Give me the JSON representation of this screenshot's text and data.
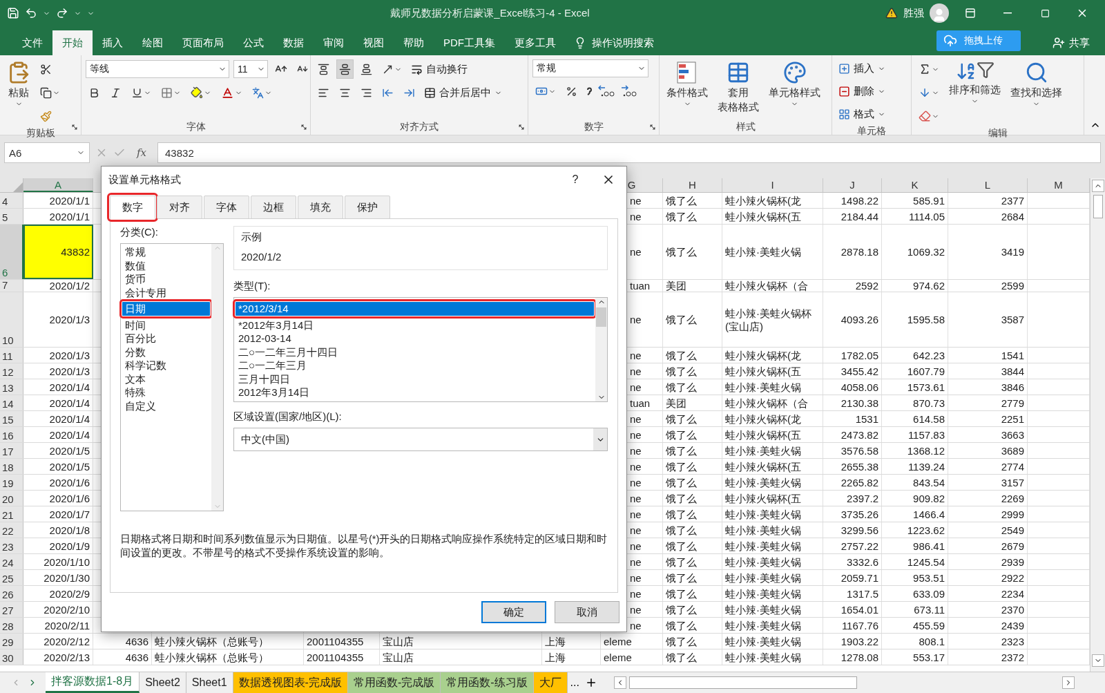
{
  "title_bar": {
    "title": "戴师兄数据分析启蒙课_Excel练习-4  -  Excel",
    "user": "胜强"
  },
  "menu_tabs": [
    {
      "label": "文件",
      "selected": false
    },
    {
      "label": "开始",
      "selected": true
    },
    {
      "label": "插入",
      "selected": false
    },
    {
      "label": "绘图",
      "selected": false
    },
    {
      "label": "页面布局",
      "selected": false
    },
    {
      "label": "公式",
      "selected": false
    },
    {
      "label": "数据",
      "selected": false
    },
    {
      "label": "审阅",
      "selected": false
    },
    {
      "label": "视图",
      "selected": false
    },
    {
      "label": "帮助",
      "selected": false
    },
    {
      "label": "PDF工具集",
      "selected": false
    },
    {
      "label": "更多工具",
      "selected": false
    }
  ],
  "search_hint": "操作说明搜索",
  "upload_button": "拖拽上传",
  "share_button": "共享",
  "ribbon": {
    "clipboard": {
      "paste": "粘贴",
      "group": "剪贴板"
    },
    "font": {
      "name": "等线",
      "size": "11",
      "group": "字体"
    },
    "alignment": {
      "vertical": [
        {
          "selected": false
        },
        {
          "selected": true
        },
        {
          "selected": false
        }
      ],
      "wrap": "自动换行",
      "merge": "合并后居中",
      "group": "对齐方式"
    },
    "number": {
      "format": "常规",
      "group": "数字"
    },
    "styles": {
      "conditional": [
        "条件格式"
      ],
      "table": [
        "套用",
        "表格格式"
      ],
      "cell": [
        "单元格样式"
      ],
      "group": "样式"
    },
    "cells": {
      "insert": "插入",
      "delete": "删除",
      "format": "格式",
      "group": "单元格"
    },
    "editing": {
      "sort": "排序和筛选",
      "find": "查找和选择",
      "group": "编辑"
    }
  },
  "formula_bar": {
    "cell_name": "A6",
    "function_button": "fx",
    "value": "43832"
  },
  "column_headers": [
    {
      "label": "A",
      "selected": true
    },
    {
      "label": "G",
      "selected": false
    },
    {
      "label": "H",
      "selected": false
    },
    {
      "label": "I",
      "selected": false
    },
    {
      "label": "J",
      "selected": false
    },
    {
      "label": "K",
      "selected": false
    },
    {
      "label": "L",
      "selected": false
    },
    {
      "label": "M",
      "selected": false
    }
  ],
  "rows": [
    {
      "number": "4",
      "kind": "normal",
      "selected": false,
      "cells": {
        "A": "2020/1/1",
        "G": "ne",
        "H": "饿了么",
        "I": "蛙小辣火锅杯(龙",
        "J": "1498.22",
        "K": "585.91",
        "L": "2377"
      }
    },
    {
      "number": "5",
      "kind": "normal",
      "selected": false,
      "cells": {
        "A": "2020/1/1",
        "G": "ne",
        "H": "饿了么",
        "I": "蛙小辣火锅杯(五",
        "J": "2184.44",
        "K": "1114.05",
        "L": "2684"
      }
    },
    {
      "number": "6",
      "kind": "tall",
      "selected": true,
      "color": "#ffff00",
      "cells": {
        "A": "43832",
        "G": "ne",
        "H": "饿了么",
        "I": "蛙小辣·美蛙火锅",
        "J": "2878.18",
        "K": "1069.32",
        "L": "3419"
      }
    },
    {
      "number": "7",
      "kind": "short",
      "selected": false,
      "cells": {
        "A": "2020/1/2",
        "G": "tuan",
        "H": "美团",
        "I": "蛙小辣火锅杯（合",
        "J": "2592",
        "K": "974.62",
        "L": "2599"
      }
    },
    {
      "number": "10",
      "kind": "tall",
      "selected": false,
      "cells": {
        "A": "2020/1/3",
        "G": "ne",
        "H": "饿了么",
        "I": "蛙小辣·美蛙火锅杯(宝山店)",
        "J": "4093.26",
        "K": "1595.58",
        "L": "3587"
      }
    },
    {
      "number": "11",
      "kind": "normal",
      "selected": false,
      "cells": {
        "A": "2020/1/3",
        "G": "ne",
        "H": "饿了么",
        "I": "蛙小辣火锅杯(龙",
        "J": "1782.05",
        "K": "642.23",
        "L": "1541"
      }
    },
    {
      "number": "12",
      "kind": "normal",
      "selected": false,
      "cells": {
        "A": "2020/1/3",
        "G": "ne",
        "H": "饿了么",
        "I": "蛙小辣火锅杯(五",
        "J": "3455.42",
        "K": "1607.79",
        "L": "3844"
      }
    },
    {
      "number": "13",
      "kind": "normal",
      "selected": false,
      "cells": {
        "A": "2020/1/4",
        "G": "ne",
        "H": "饿了么",
        "I": "蛙小辣·美蛙火锅",
        "J": "4058.06",
        "K": "1573.61",
        "L": "3846"
      }
    },
    {
      "number": "14",
      "kind": "normal",
      "selected": false,
      "cells": {
        "A": "2020/1/4",
        "G": "tuan",
        "H": "美团",
        "I": "蛙小辣火锅杯（合",
        "J": "2130.38",
        "K": "870.73",
        "L": "2779"
      }
    },
    {
      "number": "15",
      "kind": "normal",
      "selected": false,
      "cells": {
        "A": "2020/1/4",
        "G": "ne",
        "H": "饿了么",
        "I": "蛙小辣火锅杯(龙",
        "J": "1531",
        "K": "614.58",
        "L": "2251"
      }
    },
    {
      "number": "16",
      "kind": "normal",
      "selected": false,
      "cells": {
        "A": "2020/1/4",
        "G": "ne",
        "H": "饿了么",
        "I": "蛙小辣火锅杯(五",
        "J": "2473.82",
        "K": "1157.83",
        "L": "3663"
      }
    },
    {
      "number": "17",
      "kind": "normal",
      "selected": false,
      "cells": {
        "A": "2020/1/5",
        "G": "ne",
        "H": "饿了么",
        "I": "蛙小辣·美蛙火锅",
        "J": "3576.58",
        "K": "1368.12",
        "L": "3689"
      }
    },
    {
      "number": "18",
      "kind": "normal",
      "selected": false,
      "cells": {
        "A": "2020/1/5",
        "G": "ne",
        "H": "饿了么",
        "I": "蛙小辣火锅杯(五",
        "J": "2655.38",
        "K": "1139.24",
        "L": "2774"
      }
    },
    {
      "number": "19",
      "kind": "normal",
      "selected": false,
      "cells": {
        "A": "2020/1/6",
        "G": "ne",
        "H": "饿了么",
        "I": "蛙小辣·美蛙火锅",
        "J": "2265.82",
        "K": "843.54",
        "L": "3157"
      }
    },
    {
      "number": "20",
      "kind": "normal",
      "selected": false,
      "cells": {
        "A": "2020/1/6",
        "G": "ne",
        "H": "饿了么",
        "I": "蛙小辣火锅杯(五",
        "J": "2397.2",
        "K": "909.82",
        "L": "2269"
      }
    },
    {
      "number": "21",
      "kind": "normal",
      "selected": false,
      "cells": {
        "A": "2020/1/7",
        "G": "ne",
        "H": "饿了么",
        "I": "蛙小辣·美蛙火锅",
        "J": "3735.26",
        "K": "1466.4",
        "L": "2999"
      }
    },
    {
      "number": "22",
      "kind": "normal",
      "selected": false,
      "cells": {
        "A": "2020/1/8",
        "G": "ne",
        "H": "饿了么",
        "I": "蛙小辣·美蛙火锅",
        "J": "3299.56",
        "K": "1223.62",
        "L": "2549"
      }
    },
    {
      "number": "23",
      "kind": "normal",
      "selected": false,
      "cells": {
        "A": "2020/1/9",
        "G": "ne",
        "H": "饿了么",
        "I": "蛙小辣·美蛙火锅",
        "J": "2757.22",
        "K": "986.41",
        "L": "2679"
      }
    },
    {
      "number": "24",
      "kind": "normal",
      "selected": false,
      "cells": {
        "A": "2020/1/10",
        "G": "ne",
        "H": "饿了么",
        "I": "蛙小辣·美蛙火锅",
        "J": "3332.6",
        "K": "1245.54",
        "L": "2939"
      }
    },
    {
      "number": "25",
      "kind": "normal",
      "selected": false,
      "cells": {
        "A": "2020/1/30",
        "G": "ne",
        "H": "饿了么",
        "I": "蛙小辣·美蛙火锅",
        "J": "2059.71",
        "K": "953.51",
        "L": "2922"
      }
    },
    {
      "number": "26",
      "kind": "normal",
      "selected": false,
      "cells": {
        "A": "2020/2/9",
        "G": "ne",
        "H": "饿了么",
        "I": "蛙小辣·美蛙火锅",
        "J": "1317.5",
        "K": "633.09",
        "L": "2234"
      }
    },
    {
      "number": "27",
      "kind": "normal",
      "selected": false,
      "cells": {
        "A": "2020/2/10",
        "G": "ne",
        "H": "饿了么",
        "I": "蛙小辣·美蛙火锅",
        "J": "1654.01",
        "K": "673.11",
        "L": "2370"
      }
    },
    {
      "number": "28",
      "kind": "normal",
      "selected": false,
      "cells": {
        "A": "2020/2/11",
        "G": "ne",
        "H": "饿了么",
        "I": "蛙小辣·美蛙火锅",
        "J": "1167.76",
        "K": "455.59",
        "L": "2439"
      }
    },
    {
      "number": "29",
      "kind": "normal",
      "selected": false,
      "cells": {
        "A": "2020/2/12",
        "B": "4636",
        "C": "蛙小辣火锅杯（总账号）",
        "D": "2001104355",
        "E": "宝山店",
        "F": "上海",
        "G": "eleme",
        "H": "饿了么",
        "I": "蛙小辣·美蛙火锅",
        "J": "1903.22",
        "K": "808.1",
        "L": "2323"
      }
    },
    {
      "number": "30",
      "kind": "normal",
      "selected": false,
      "cells": {
        "A": "2020/2/13",
        "B": "4636",
        "C": "蛙小辣火锅杯（总账号）",
        "D": "2001104355",
        "E": "宝山店",
        "F": "上海",
        "G": "eleme",
        "H": "饿了么",
        "I": "蛙小辣·美蛙火锅",
        "J": "1278.08",
        "K": "553.17",
        "L": "2372"
      }
    }
  ],
  "dialog": {
    "title": "设置单元格格式",
    "help": "?",
    "tabs": [
      {
        "label": "数字",
        "selected": true,
        "highlighted": true
      },
      {
        "label": "对齐",
        "selected": false,
        "highlighted": false
      },
      {
        "label": "字体",
        "selected": false,
        "highlighted": false
      },
      {
        "label": "边框",
        "selected": false,
        "highlighted": false
      },
      {
        "label": "填充",
        "selected": false,
        "highlighted": false
      },
      {
        "label": "保护",
        "selected": false,
        "highlighted": false
      }
    ],
    "category_label": "分类(C):",
    "categories": [
      {
        "label": "常规",
        "selected": false,
        "highlighted": false
      },
      {
        "label": "数值",
        "selected": false,
        "highlighted": false
      },
      {
        "label": "货币",
        "selected": false,
        "highlighted": false
      },
      {
        "label": "会计专用",
        "selected": false,
        "highlighted": false
      },
      {
        "label": "日期",
        "selected": true,
        "highlighted": true
      },
      {
        "label": "时间",
        "selected": false,
        "highlighted": false
      },
      {
        "label": "百分比",
        "selected": false,
        "highlighted": false
      },
      {
        "label": "分数",
        "selected": false,
        "highlighted": false
      },
      {
        "label": "科学记数",
        "selected": false,
        "highlighted": false
      },
      {
        "label": "文本",
        "selected": false,
        "highlighted": false
      },
      {
        "label": "特殊",
        "selected": false,
        "highlighted": false
      },
      {
        "label": "自定义",
        "selected": false,
        "highlighted": false
      }
    ],
    "sample_label": "示例",
    "sample": "2020/1/2",
    "type_label": "类型(T):",
    "types": [
      {
        "label": "*2012/3/14",
        "selected": true,
        "highlighted": true
      },
      {
        "label": "*2012年3月14日",
        "selected": false,
        "highlighted": false
      },
      {
        "label": "2012-03-14",
        "selected": false,
        "highlighted": false
      },
      {
        "label": "二○一二年三月十四日",
        "selected": false,
        "highlighted": false
      },
      {
        "label": "二○一二年三月",
        "selected": false,
        "highlighted": false
      },
      {
        "label": "三月十四日",
        "selected": false,
        "highlighted": false
      },
      {
        "label": "2012年3月14日",
        "selected": false,
        "highlighted": false
      }
    ],
    "locale_label": "区域设置(国家/地区)(L):",
    "locale": "中文(中国)",
    "description": "日期格式将日期和时间系列数值显示为日期值。以星号(*)开头的日期格式响应操作系统特定的区域日期和时间设置的更改。不带星号的格式不受操作系统设置的影响。",
    "ok": "确定",
    "cancel": "取消"
  },
  "sheet_tabs": [
    {
      "label": "拌客源数据1-8月",
      "selected": true
    },
    {
      "label": "Sheet2",
      "selected": false
    },
    {
      "label": "Sheet1",
      "selected": false
    },
    {
      "label": "数据透视图表-完成版",
      "selected": false,
      "color": "#ffc000"
    },
    {
      "label": "常用函数-完成版",
      "selected": false,
      "color": "#a9d08e"
    },
    {
      "label": "常用函数-练习版",
      "selected": false,
      "color": "#a9d08e"
    },
    {
      "label": "大厂",
      "selected": false,
      "color": "#ffc000"
    }
  ],
  "more_tabs": "..."
}
